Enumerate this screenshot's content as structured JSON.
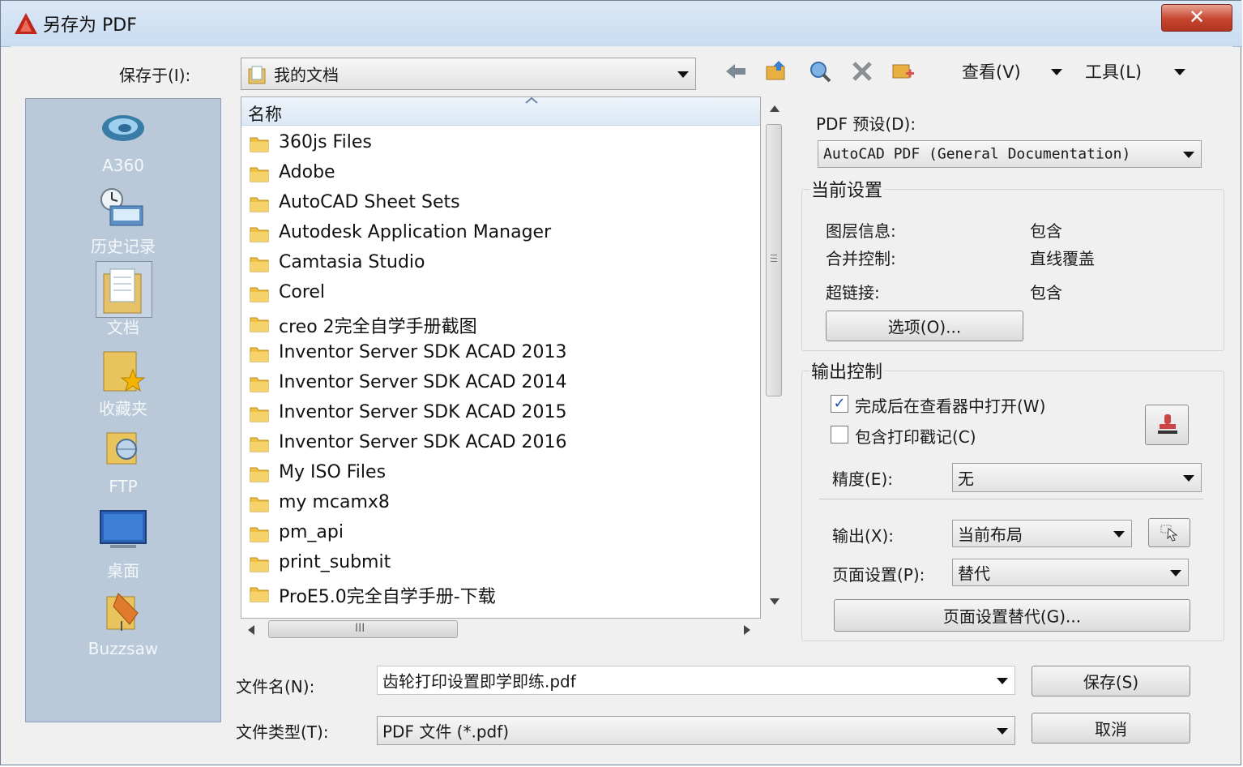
{
  "window": {
    "title": "另存为 PDF",
    "close_glyph": "✕"
  },
  "toolbar": {
    "save_in_label": "保存于(I):",
    "save_in_value": "我的文档",
    "icons": [
      "back-icon",
      "up-folder-icon",
      "search-web-icon",
      "delete-icon",
      "new-folder-icon"
    ],
    "view_label": "查看(V)",
    "tools_label": "工具(L)"
  },
  "places": [
    {
      "label": "A360",
      "icon": "a360-cloud-icon"
    },
    {
      "label": "历史记录",
      "icon": "history-icon"
    },
    {
      "label": "文档",
      "icon": "documents-folder-icon"
    },
    {
      "label": "收藏夹",
      "icon": "favorites-icon"
    },
    {
      "label": "FTP",
      "icon": "ftp-icon"
    },
    {
      "label": "桌面",
      "icon": "desktop-icon"
    },
    {
      "label": "Buzzsaw",
      "icon": "buzzsaw-icon"
    }
  ],
  "file_list": {
    "column_header": "名称",
    "items": [
      "360js Files",
      "Adobe",
      "AutoCAD Sheet Sets",
      "Autodesk Application Manager",
      "Camtasia Studio",
      "Corel",
      "creo 2完全自学手册截图",
      "Inventor Server SDK ACAD 2013",
      "Inventor Server SDK ACAD 2014",
      "Inventor Server SDK ACAD 2015",
      "Inventor Server SDK ACAD 2016",
      "My ISO Files",
      "my mcamx8",
      "pm_api",
      "print_submit",
      "ProE5.0完全自学手册-下载"
    ],
    "hscroll_grip": "III"
  },
  "pdf_settings": {
    "preset_label": "PDF 预设(D):",
    "preset_value": "AutoCAD PDF (General Documentation)",
    "current_group_title": "当前设置",
    "rows": [
      {
        "label": "图层信息:",
        "value": "包含"
      },
      {
        "label": "合并控制:",
        "value": "直线覆盖"
      },
      {
        "label": "超链接:",
        "value": "包含"
      }
    ],
    "options_button": "选项(O)...",
    "output_group_title": "输出控制",
    "open_in_viewer_label": "完成后在查看器中打开(W)",
    "open_in_viewer_checked": true,
    "include_stamp_label": "包含打印戳记(C)",
    "include_stamp_checked": false,
    "precision_label": "精度(E):",
    "precision_value": "无",
    "output_label": "输出(X):",
    "output_value": "当前布局",
    "page_setup_label": "页面设置(P):",
    "page_setup_value": "替代",
    "page_setup_override_button": "页面设置替代(G)..."
  },
  "footer": {
    "filename_label": "文件名(N):",
    "filename_value": "齿轮打印设置即学即练.pdf",
    "filetype_label": "文件类型(T):",
    "filetype_value": "PDF 文件 (*.pdf)",
    "save_button": "保存(S)",
    "cancel_button": "取消"
  },
  "colors": {
    "title_bar": "#c9dcf1",
    "places_bg": "#b9c9da",
    "close_red": "#c6452f",
    "folder_yellow": "#f0c040",
    "check_blue": "#1a4fb0"
  }
}
